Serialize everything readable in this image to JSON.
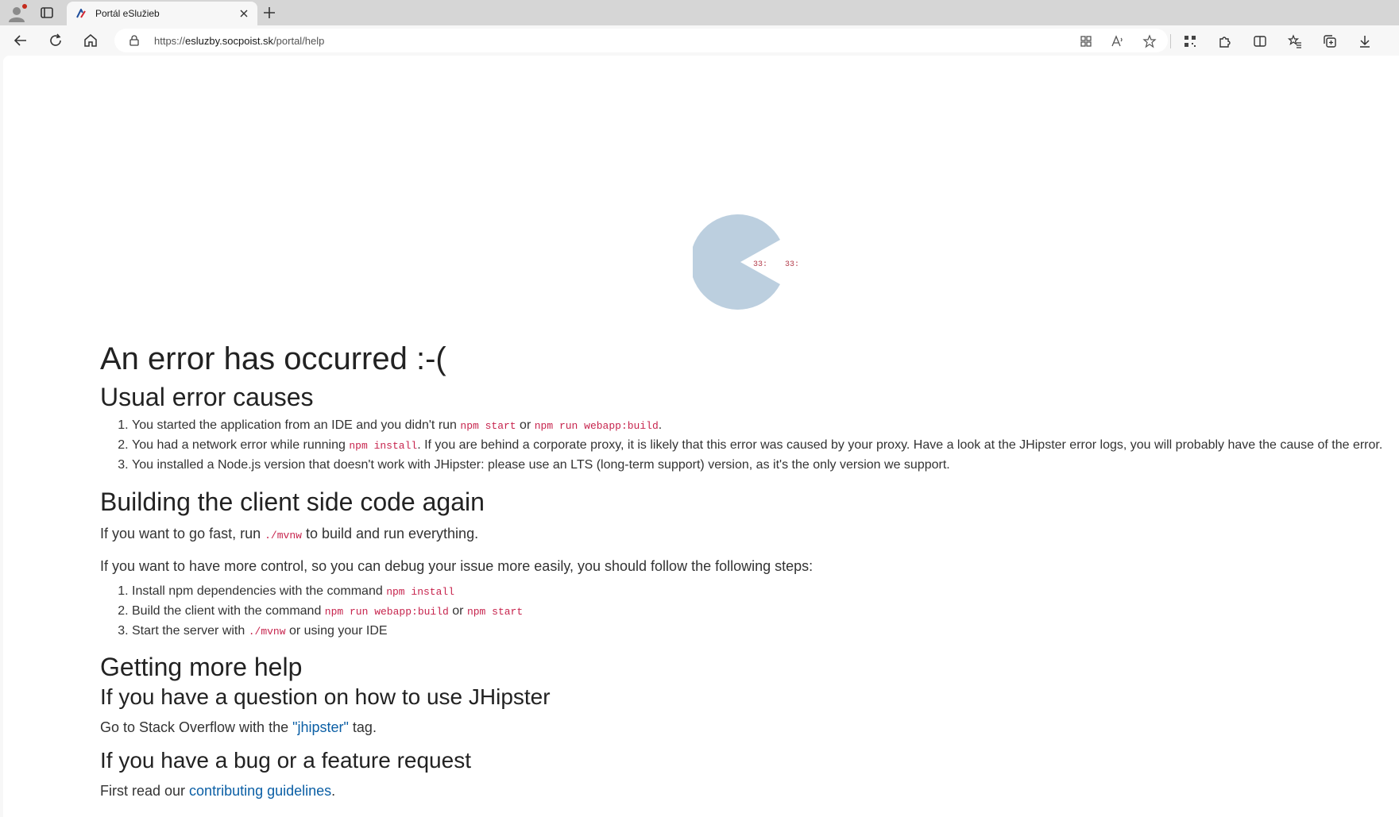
{
  "browser": {
    "tab_title": "Portál eSlužieb",
    "url_prefix": "https://",
    "url_host": "esluzby.socpoist.sk",
    "url_path": "/portal/help"
  },
  "page": {
    "title": "An error has occurred :-(",
    "usual_causes": {
      "heading": "Usual error causes",
      "items": [
        {
          "pre": "You started the application from an IDE and you didn't run ",
          "code1": "npm start",
          "mid": " or ",
          "code2": "npm run webapp:build",
          "post": "."
        },
        {
          "pre": "You had a network error while running ",
          "code1": "npm install",
          "post": ". If you are behind a corporate proxy, it is likely that this error was caused by your proxy. Have a look at the JHipster error logs, you will probably have the cause of the error."
        },
        {
          "text": "You installed a Node.js version that doesn't work with JHipster: please use an LTS (long-term support) version, as it's the only version we support."
        }
      ]
    },
    "building": {
      "heading": "Building the client side code again",
      "fast_pre": "If you want to go fast, run ",
      "fast_code": "./mvnw",
      "fast_post": " to build and run everything.",
      "control": "If you want to have more control, so you can debug your issue more easily, you should follow the following steps:",
      "steps": [
        {
          "pre": "Install npm dependencies with the command ",
          "code1": "npm install"
        },
        {
          "pre": "Build the client with the command ",
          "code1": "npm run webapp:build",
          "mid": " or ",
          "code2": "npm start"
        },
        {
          "pre": "Start the server with ",
          "code1": "./mvnw",
          "post": " or using your IDE"
        }
      ]
    },
    "help": {
      "heading": "Getting more help",
      "question_heading": "If you have a question on how to use JHipster",
      "question_pre": "Go to Stack Overflow with the ",
      "question_link": "\"jhipster\"",
      "question_post": " tag.",
      "bug_heading": "If you have a bug or a feature request",
      "bug_pre": "First read our ",
      "bug_link": "contributing guidelines",
      "bug_post": "."
    },
    "loader_colors": {
      "body": "#bccfdf",
      "dots": "#b5414f"
    }
  }
}
